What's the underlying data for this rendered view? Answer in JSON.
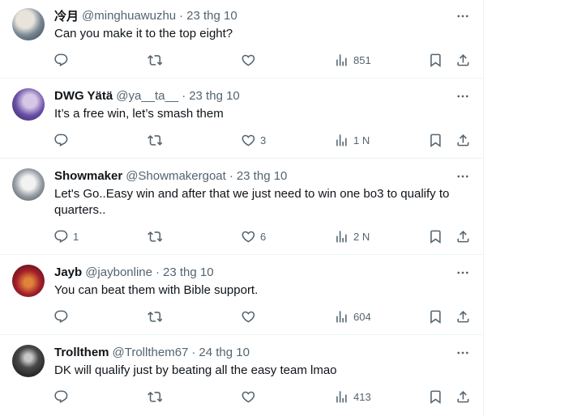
{
  "tweets": [
    {
      "name": "冷月",
      "handle": "@minghuawuzhu",
      "date": "23 thg 10",
      "text": "Can you make it to the top eight?",
      "replies": "",
      "reposts": "",
      "likes": "",
      "views": "851"
    },
    {
      "name": "DWG Yätä",
      "handle": "@ya__ta__",
      "date": "23 thg 10",
      "text": "It’s a free win, let’s smash them",
      "replies": "",
      "reposts": "",
      "likes": "3",
      "views": "1 N"
    },
    {
      "name": "Showmaker",
      "handle": "@Showmakergoat",
      "date": "23 thg 10",
      "text": "Let's Go..Easy win and after that we just need to win one bo3 to qualify to quarters..",
      "replies": "1",
      "reposts": "",
      "likes": "6",
      "views": "2 N"
    },
    {
      "name": "Jayb",
      "handle": "@jaybonline",
      "date": "23 thg 10",
      "text": "You can beat them with Bible support.",
      "replies": "",
      "reposts": "",
      "likes": "",
      "views": "604"
    },
    {
      "name": "Trollthem",
      "handle": "@Trollthem67",
      "date": "24 thg 10",
      "text": "DK will qualify just by beating all the easy team lmao",
      "replies": "",
      "reposts": "",
      "likes": "",
      "views": "413"
    }
  ],
  "icons": {
    "reply": "reply-icon",
    "repost": "repost-icon",
    "like": "heart-icon",
    "views": "views-icon",
    "bookmark": "bookmark-icon",
    "share": "share-icon",
    "more": "more-icon"
  },
  "colors": {
    "text": "#0f1419",
    "secondary": "#536471",
    "border": "#eff3f4"
  }
}
